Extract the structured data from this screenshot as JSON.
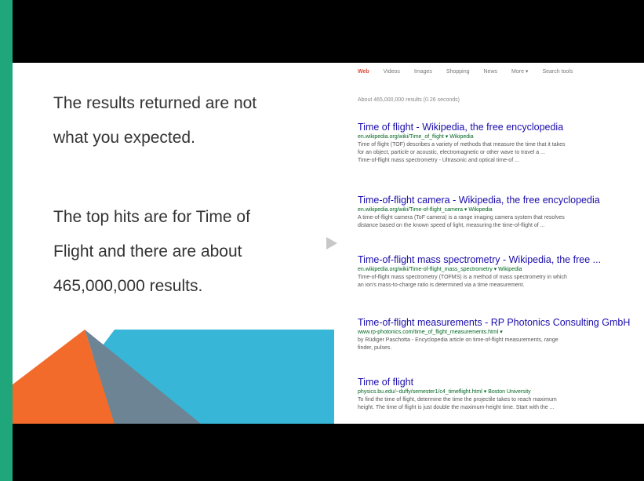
{
  "slide": {
    "paragraph1": [
      "The results returned are not",
      "what you expected."
    ],
    "paragraph2": [
      "The top hits are for Time of",
      "Flight and there are about",
      "465,000,000 results."
    ]
  },
  "colors": {
    "frame": "#1fa67a",
    "letterbox": "#000000",
    "orange": "#f26b2b",
    "cyan": "#38b6d8",
    "slate": "#6c8493",
    "link": "#1a0dab",
    "url": "#006621"
  },
  "serp": {
    "nav": [
      "Web",
      "Videos",
      "Images",
      "Shopping",
      "News",
      "More ▾",
      "Search tools"
    ],
    "active_tab": "Web",
    "stats": "About 465,000,000 results (0.26 seconds)",
    "results": [
      {
        "title": "Time of flight - Wikipedia, the free encyclopedia",
        "url": "en.wikipedia.org/wiki/Time_of_flight ▾ Wikipedia",
        "snippet": [
          "Time of flight (TOF) describes a variety of methods that measure the time that it takes",
          "for an object, particle or acoustic, electromagnetic or other wave to travel a ...",
          "Time-of-flight mass spectrometry - Ultrasonic and optical time-of ..."
        ]
      },
      {
        "title": "Time-of-flight camera - Wikipedia, the free encyclopedia",
        "url": "en.wikipedia.org/wiki/Time-of-flight_camera ▾ Wikipedia",
        "snippet": [
          "A time-of-flight camera (ToF camera) is a range imaging camera system that resolves",
          "distance based on the known speed of light, measuring the time-of-flight of ..."
        ]
      },
      {
        "title": "Time-of-flight mass spectrometry - Wikipedia, the free ...",
        "url": "en.wikipedia.org/wiki/Time-of-flight_mass_spectrometry ▾ Wikipedia",
        "snippet": [
          "Time-of-flight mass spectrometry (TOFMS) is a method of mass spectrometry in which",
          "an ion's mass-to-charge ratio is determined via a time measurement."
        ]
      },
      {
        "title": "Time-of-flight measurements - RP Photonics Consulting GmbH",
        "url": "www.rp-photonics.com/time_of_flight_measurements.html ▾",
        "snippet": [
          "by Rüdiger Paschotta - Encyclopedia article on time-of-flight measurements, range",
          "finder, pulses."
        ]
      },
      {
        "title": "Time of flight",
        "url": "physics.bu.edu/~duffy/semester1/c4_timeflight.html ▾ Boston University",
        "snippet": [
          "To find the time of flight, determine the time the projectile takes to reach maximum",
          "height. The time of flight is just double the maximum-height time. Start with the ..."
        ]
      }
    ]
  }
}
